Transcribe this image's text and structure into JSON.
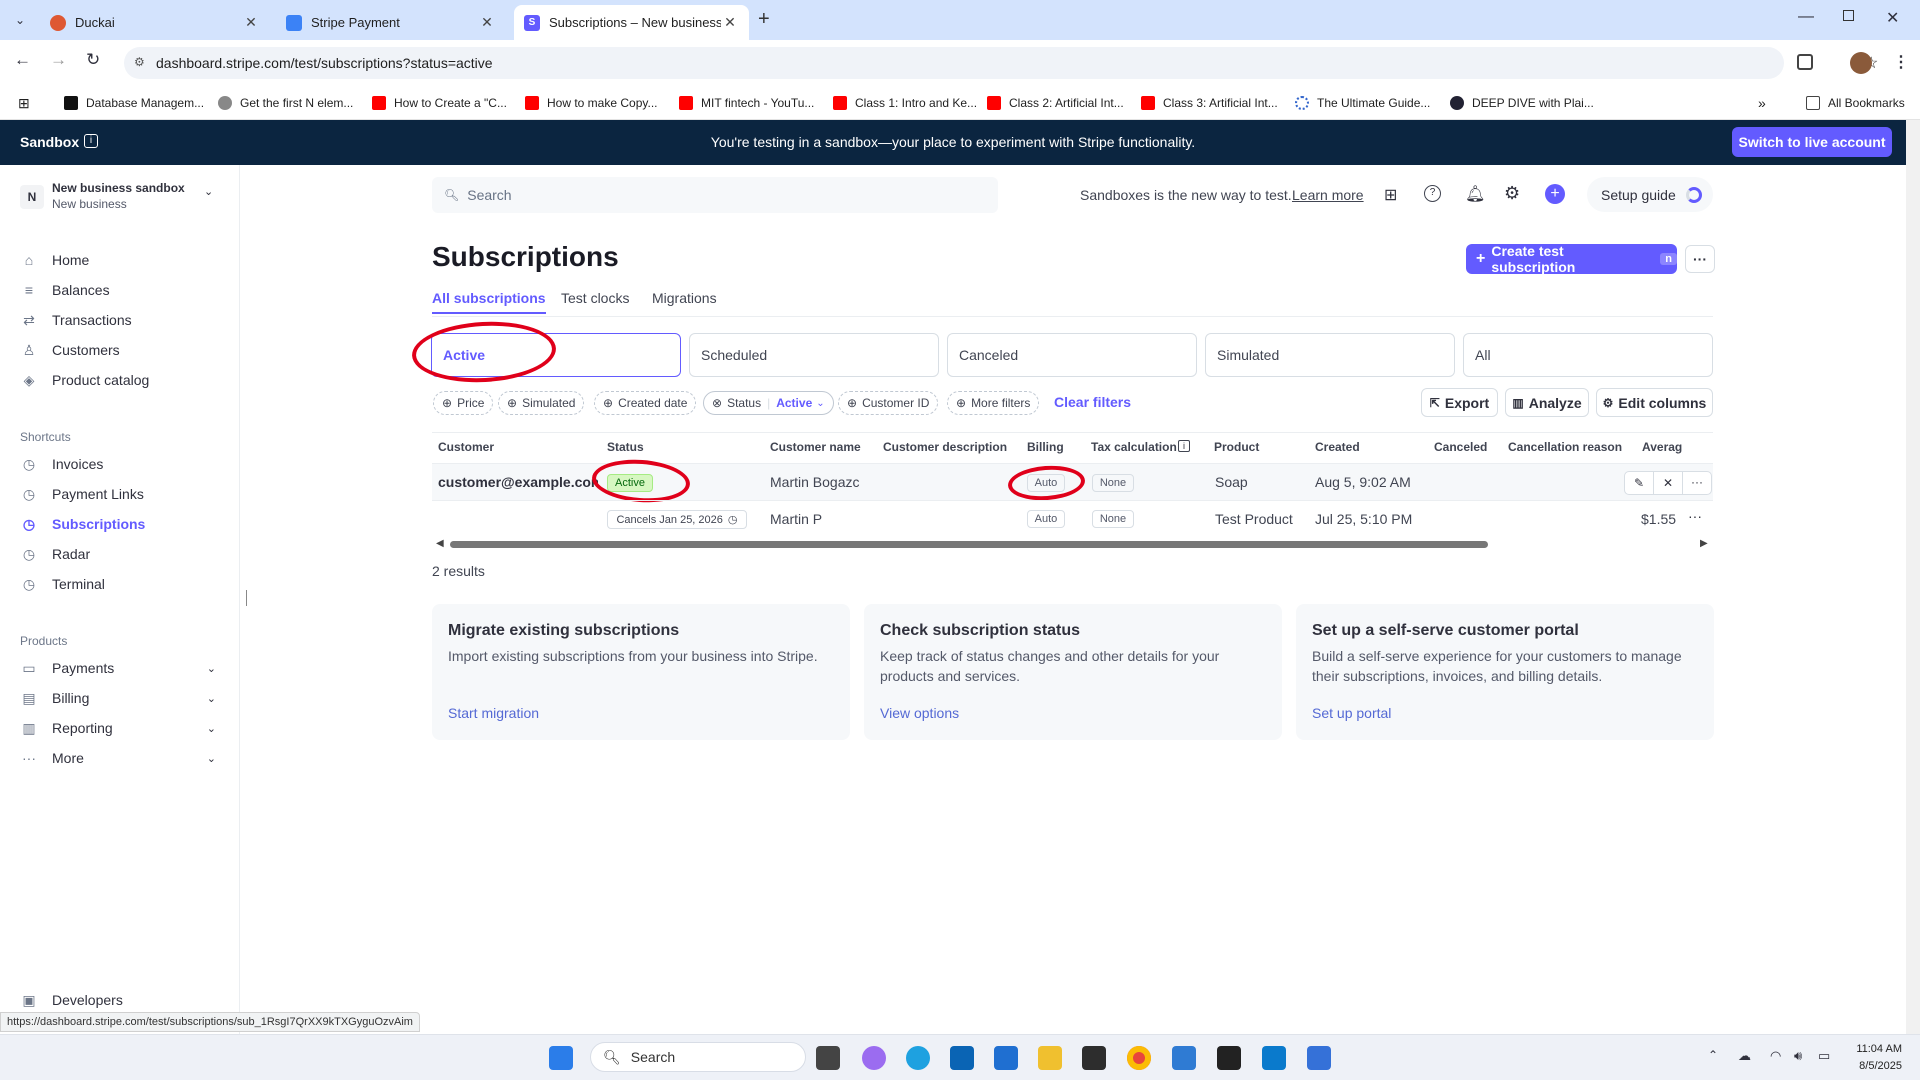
{
  "browser": {
    "tabs": [
      {
        "label": "Duckai"
      },
      {
        "label": "Stripe Payment"
      },
      {
        "label": "Subscriptions – New business sa"
      }
    ],
    "url": "dashboard.stripe.com/test/subscriptions?status=active",
    "bookmarks": [
      "Database Managem...",
      "Get the first N elem...",
      "How to Create a \"C...",
      "How to make Copy...",
      "MIT fintech - YouTu...",
      "Class 1: Intro and Ke...",
      "Class 2: Artificial Int...",
      "Class 3: Artificial Int...",
      "The Ultimate Guide...",
      "DEEP DIVE with Plai..."
    ],
    "all_bookmarks": "All Bookmarks",
    "status_url": "https://dashboard.stripe.com/test/subscriptions/sub_1RsgI7QrXX9kTXGyguOzvAim"
  },
  "banner": {
    "label": "Sandbox",
    "message": "You're testing in a sandbox—your place to experiment with Stripe functionality.",
    "switch_button": "Switch to live account"
  },
  "account": {
    "initial": "N",
    "name": "New business sandbox",
    "sub": "New business"
  },
  "sidebar": {
    "main": [
      "Home",
      "Balances",
      "Transactions",
      "Customers",
      "Product catalog"
    ],
    "shortcuts_title": "Shortcuts",
    "shortcuts": [
      "Invoices",
      "Payment Links",
      "Subscriptions",
      "Radar",
      "Terminal"
    ],
    "products_title": "Products",
    "products": [
      "Payments",
      "Billing",
      "Reporting",
      "More"
    ],
    "developers": "Developers"
  },
  "topbar": {
    "search_placeholder": "Search",
    "sandbox_note": "Sandboxes is the new way to test.",
    "learn_more": "Learn more",
    "setup_guide": "Setup guide"
  },
  "page": {
    "title": "Subscriptions",
    "create_button": "Create test subscription",
    "create_kbd": "n",
    "more": "···"
  },
  "subtabs": [
    "All subscriptions",
    "Test clocks",
    "Migrations"
  ],
  "filter_tabs": [
    "Active",
    "Scheduled",
    "Canceled",
    "Simulated",
    "All"
  ],
  "chips": {
    "price": "Price",
    "simulated": "Simulated",
    "created": "Created date",
    "status": "Status",
    "status_value": "Active",
    "customer_id": "Customer ID",
    "more_filters": "More filters",
    "clear": "Clear filters"
  },
  "actions": {
    "export": "Export",
    "analyze": "Analyze",
    "edit_columns": "Edit columns"
  },
  "table": {
    "headers": [
      "Customer",
      "Status",
      "Customer name",
      "Customer description",
      "Billing",
      "Tax calculation",
      "Product",
      "Created",
      "Canceled",
      "Cancellation reason",
      "Averag"
    ],
    "rows": [
      {
        "customer": "customer@example.com",
        "status": "Active",
        "name": "Martin Bogazc",
        "billing": "Auto",
        "tax": "None",
        "product": "Soap",
        "created": "Aug 5, 9:02 AM",
        "avg": ""
      },
      {
        "customer": "",
        "status": "Cancels Jan 25, 2026",
        "name": "Martin P",
        "billing": "Auto",
        "tax": "None",
        "product": "Test Product",
        "created": "Jul 25, 5:10 PM",
        "avg": "$1.55"
      }
    ],
    "results": "2 results"
  },
  "cards": [
    {
      "title": "Migrate existing subscriptions",
      "body": "Import existing subscriptions from your business into Stripe.",
      "link": "Start migration"
    },
    {
      "title": "Check subscription status",
      "body": "Keep track of status changes and other details for your products and services.",
      "link": "View options"
    },
    {
      "title": "Set up a self-serve customer portal",
      "body": "Build a self-serve experience for your customers to manage their subscriptions, invoices, and billing details.",
      "link": "Set up portal"
    }
  ],
  "taskbar": {
    "search": "Search",
    "time": "11:04 AM",
    "date": "8/5/2025"
  },
  "colors": {
    "accent": "#635bff",
    "banner": "#0b2540",
    "annotation": "#e0001a"
  }
}
